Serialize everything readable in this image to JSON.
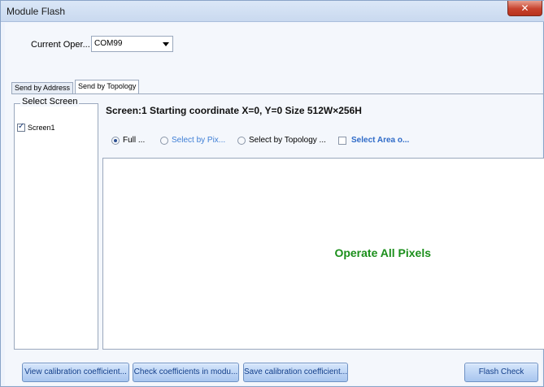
{
  "window": {
    "title": "Module Flash",
    "close_label": "✕"
  },
  "operation": {
    "label": "Current Oper...",
    "port_value": "COM99"
  },
  "tabs": [
    {
      "label": "Send by Address",
      "selected": false
    },
    {
      "label": "Send by Topology",
      "selected": true
    }
  ],
  "select_screen": {
    "title": "Select Screen",
    "items": [
      {
        "label": "Screen1",
        "checked": true
      }
    ]
  },
  "screen_info": "Screen:1  Starting coordinate X=0, Y=0  Size 512W×256H",
  "options": {
    "full": "Full ...",
    "by_pixel": "Select by Pix...",
    "by_topology": "Select by Topology ...",
    "select_area": "Select Area o...",
    "selected": "full"
  },
  "pixel_area_text": "Operate All Pixels",
  "buttons": {
    "view": "View calibration coefficient...",
    "check": "Check coefficients in modu...",
    "save": "Save calibration coefficient...",
    "flash": "Flash Check"
  },
  "colors": {
    "accent_green": "#1b8f1b",
    "link_blue": "#2f6bc8",
    "button_text": "#123e8a"
  }
}
